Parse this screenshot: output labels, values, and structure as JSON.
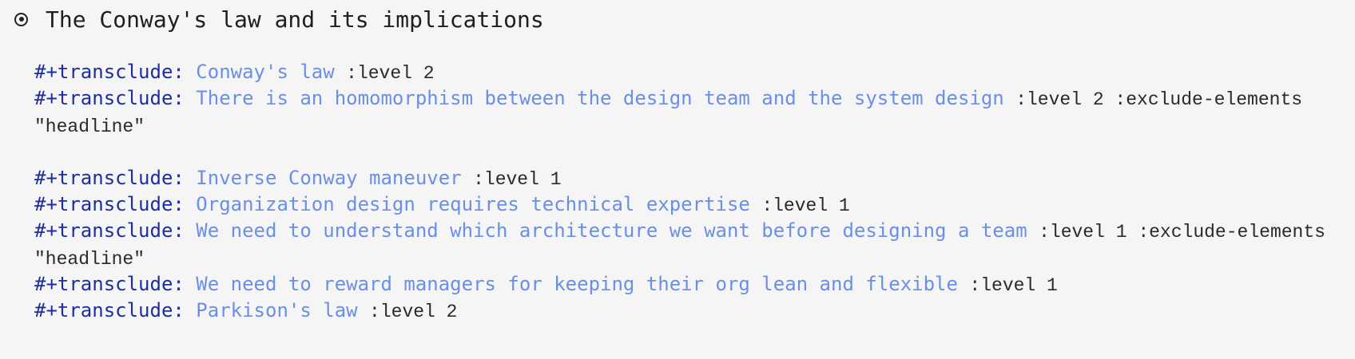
{
  "headline": {
    "title": "The Conway's law and its implications"
  },
  "keyword": "#+transclude:",
  "lines": [
    {
      "link": "Conway's law",
      "args": ":level 2"
    },
    {
      "link": "There is an homomorphism between the design team and the system design",
      "args": ":level 2 :exclude-elements",
      "cont": "\"headline\""
    },
    {
      "link": "Inverse Conway maneuver",
      "args": ":level 1"
    },
    {
      "link": "Organization design requires technical expertise",
      "args": ":level 1"
    },
    {
      "link": "We need to understand which architecture we want before designing a team",
      "args": ":level 1 :exclude-elements",
      "cont": "\"headline\""
    },
    {
      "link": "We need to reward managers for keeping their org lean and flexible",
      "args": ":level 1"
    },
    {
      "link": "Parkison's law",
      "args": ":level 2"
    }
  ]
}
